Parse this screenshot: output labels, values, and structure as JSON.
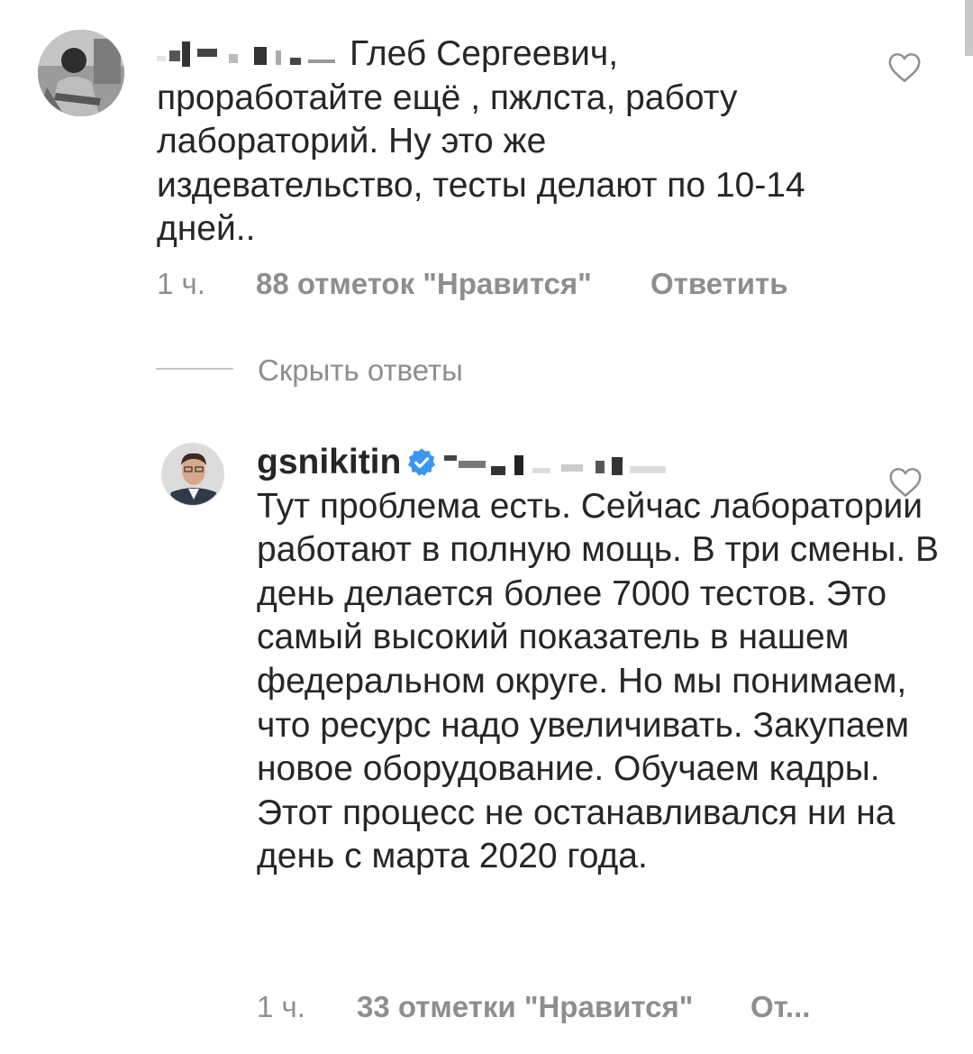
{
  "comment_parent": {
    "text": "Глеб Сергеевич, проработайте ещё , пжлста, работу лабораторий. Ну это же издевательство, тесты делают  по 10-14 дней..",
    "time": "1 ч.",
    "likes": "88 отметок \"Нравится\"",
    "reply": "Ответить"
  },
  "toggle_replies": {
    "label": "Скрыть ответы"
  },
  "comment_reply": {
    "username": "gsnikitin",
    "text": "Тут проблема есть. Сейчас лаборатории работают в полную мощь. В три смены. В день делается более 7000 тестов. Это самый высокий показатель в нашем федеральном округе. Но мы понимаем, что ресурс надо увеличивать. Закупаем новое оборудование. Обучаем кадры. Этот процесс не останавливался ни на день с марта 2020 года.",
    "time": "1 ч.",
    "likes": "33 отметки \"Нравится\"",
    "reply": "От..."
  },
  "icons": {
    "like": "heart-outline-icon",
    "verified": "verified-badge-icon"
  },
  "colors": {
    "text": "#262626",
    "meta": "#8e8e8e",
    "verified": "#3897f0"
  }
}
